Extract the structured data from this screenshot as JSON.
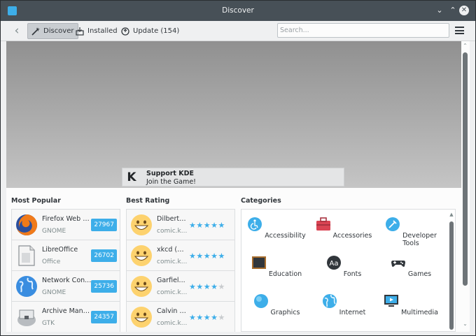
{
  "window": {
    "title": "Discover"
  },
  "toolbar": {
    "discover_label": "Discover",
    "installed_label": "Installed",
    "update_label": "Update (154)",
    "search_placeholder": "Search..."
  },
  "banner": {
    "support_title": "Support KDE",
    "support_subtitle": "Join the Game!"
  },
  "most_popular": {
    "title": "Most Popular",
    "items": [
      {
        "name": "Firefox Web B...",
        "category": "GNOME",
        "count": "27967",
        "icon": "firefox-icon"
      },
      {
        "name": "LibreOffice",
        "category": "Office",
        "count": "26702",
        "icon": "libreoffice-icon"
      },
      {
        "name": "Network Con...",
        "category": "GNOME",
        "count": "25736",
        "icon": "network-icon"
      },
      {
        "name": "Archive Mana...",
        "category": "GTK",
        "count": "24357",
        "icon": "archive-icon"
      }
    ]
  },
  "best_rating": {
    "title": "Best Rating",
    "items": [
      {
        "name": "Dilbert ...",
        "source": "comic.k...",
        "rating": 5
      },
      {
        "name": "xkcd (en)",
        "source": "comic.k...",
        "rating": 5
      },
      {
        "name": "Garfiel...",
        "source": "comic.k...",
        "rating": 4
      },
      {
        "name": "Calvin a...",
        "source": "comic.k...",
        "rating": 4
      }
    ]
  },
  "categories": {
    "title": "Categories",
    "items": [
      {
        "label": "Accessibility",
        "icon": "accessibility-icon"
      },
      {
        "label": "Accessories",
        "icon": "toolbox-icon"
      },
      {
        "label": "Developer Tools",
        "icon": "developer-tools-icon"
      },
      {
        "label": "Education",
        "icon": "chalkboard-icon"
      },
      {
        "label": "Fonts",
        "icon": "fonts-icon"
      },
      {
        "label": "Games",
        "icon": "gamepad-icon"
      },
      {
        "label": "Graphics",
        "icon": "graphics-icon"
      },
      {
        "label": "Internet",
        "icon": "globe-icon"
      },
      {
        "label": "Multimedia",
        "icon": "multimedia-icon"
      }
    ]
  },
  "colors": {
    "accent": "#3daee9",
    "titlebar": "#475057",
    "window_bg": "#eff0f1"
  }
}
